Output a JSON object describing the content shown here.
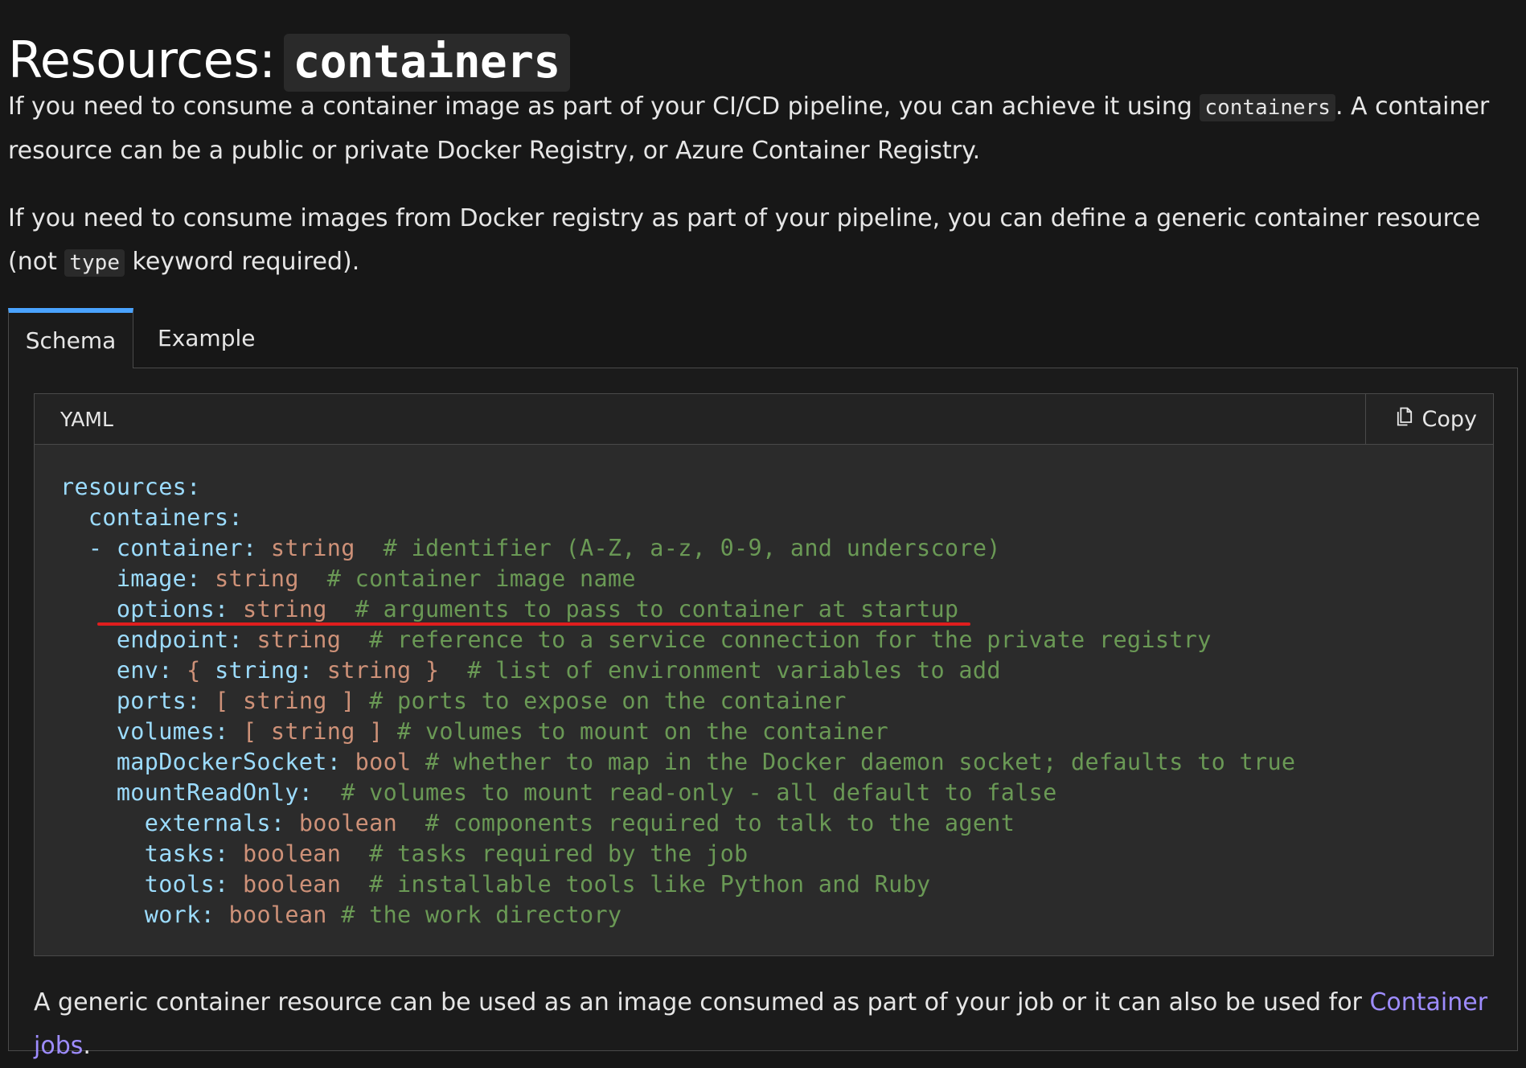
{
  "heading": {
    "prefix": "Resources:",
    "code": "containers"
  },
  "intro": {
    "p1_before": "If you need to consume a container image as part of your CI/CD pipeline, you can achieve it using ",
    "p1_code": "containers",
    "p1_after": ". A container resource can be a public or private Docker Registry, or Azure Container Registry.",
    "p2_before": "If you need to consume images from Docker registry as part of your pipeline, you can define a generic container resource (not ",
    "p2_code": "type",
    "p2_after": " keyword required)."
  },
  "tabs": [
    {
      "label": "Schema",
      "active": true
    },
    {
      "label": "Example",
      "active": false
    }
  ],
  "code_block": {
    "language": "YAML",
    "copy_label": "Copy",
    "lines": [
      [
        {
          "k": "resources:"
        }
      ],
      [
        {
          "p": "  "
        },
        {
          "k": "containers:"
        }
      ],
      [
        {
          "p": "  "
        },
        {
          "k": "- container:"
        },
        {
          "p": " "
        },
        {
          "t": "string"
        },
        {
          "p": "  "
        },
        {
          "c": "# identifier (A-Z, a-z, 0-9, and underscore)"
        }
      ],
      [
        {
          "p": "    "
        },
        {
          "k": "image:"
        },
        {
          "p": " "
        },
        {
          "t": "string"
        },
        {
          "p": "  "
        },
        {
          "c": "# container image name"
        }
      ],
      [
        {
          "p": "    "
        },
        {
          "k": "options:"
        },
        {
          "p": " "
        },
        {
          "t": "string"
        },
        {
          "p": "  "
        },
        {
          "c": "# arguments to pass to container at startup"
        }
      ],
      [
        {
          "p": "    "
        },
        {
          "k": "endpoint:"
        },
        {
          "p": " "
        },
        {
          "t": "string"
        },
        {
          "p": "  "
        },
        {
          "c": "# reference to a service connection for the private registry"
        }
      ],
      [
        {
          "p": "    "
        },
        {
          "k": "env:"
        },
        {
          "p": " "
        },
        {
          "t": "{ "
        },
        {
          "k": "string:"
        },
        {
          "p": " "
        },
        {
          "t": "string }"
        },
        {
          "p": "  "
        },
        {
          "c": "# list of environment variables to add"
        }
      ],
      [
        {
          "p": "    "
        },
        {
          "k": "ports:"
        },
        {
          "p": " "
        },
        {
          "t": "[ string ]"
        },
        {
          "p": " "
        },
        {
          "c": "# ports to expose on the container"
        }
      ],
      [
        {
          "p": "    "
        },
        {
          "k": "volumes:"
        },
        {
          "p": " "
        },
        {
          "t": "[ string ]"
        },
        {
          "p": " "
        },
        {
          "c": "# volumes to mount on the container"
        }
      ],
      [
        {
          "p": "    "
        },
        {
          "k": "mapDockerSocket:"
        },
        {
          "p": " "
        },
        {
          "t": "bool"
        },
        {
          "p": " "
        },
        {
          "c": "# whether to map in the Docker daemon socket; defaults to true"
        }
      ],
      [
        {
          "p": "    "
        },
        {
          "k": "mountReadOnly:"
        },
        {
          "p": "  "
        },
        {
          "c": "# volumes to mount read-only - all default to false"
        }
      ],
      [
        {
          "p": "      "
        },
        {
          "k": "externals:"
        },
        {
          "p": " "
        },
        {
          "t": "boolean"
        },
        {
          "p": "  "
        },
        {
          "c": "# components required to talk to the agent"
        }
      ],
      [
        {
          "p": "      "
        },
        {
          "k": "tasks:"
        },
        {
          "p": " "
        },
        {
          "t": "boolean"
        },
        {
          "p": "  "
        },
        {
          "c": "# tasks required by the job"
        }
      ],
      [
        {
          "p": "      "
        },
        {
          "k": "tools:"
        },
        {
          "p": " "
        },
        {
          "t": "boolean"
        },
        {
          "p": "  "
        },
        {
          "c": "# installable tools like Python and Ruby"
        }
      ],
      [
        {
          "p": "      "
        },
        {
          "k": "work:"
        },
        {
          "p": " "
        },
        {
          "t": "boolean"
        },
        {
          "p": " "
        },
        {
          "c": "# the work directory"
        }
      ]
    ]
  },
  "footer": {
    "text_before": "A generic container resource can be used as an image consumed as part of your job or it can also be used for ",
    "link_text": "Container jobs",
    "text_after": "."
  },
  "colors": {
    "key": "#9cdcfe",
    "type": "#ce9178",
    "comment": "#6a9955",
    "link": "#9e8cff",
    "tab_accent": "#4aa3ff",
    "annotation_underline": "#e01e1e"
  }
}
